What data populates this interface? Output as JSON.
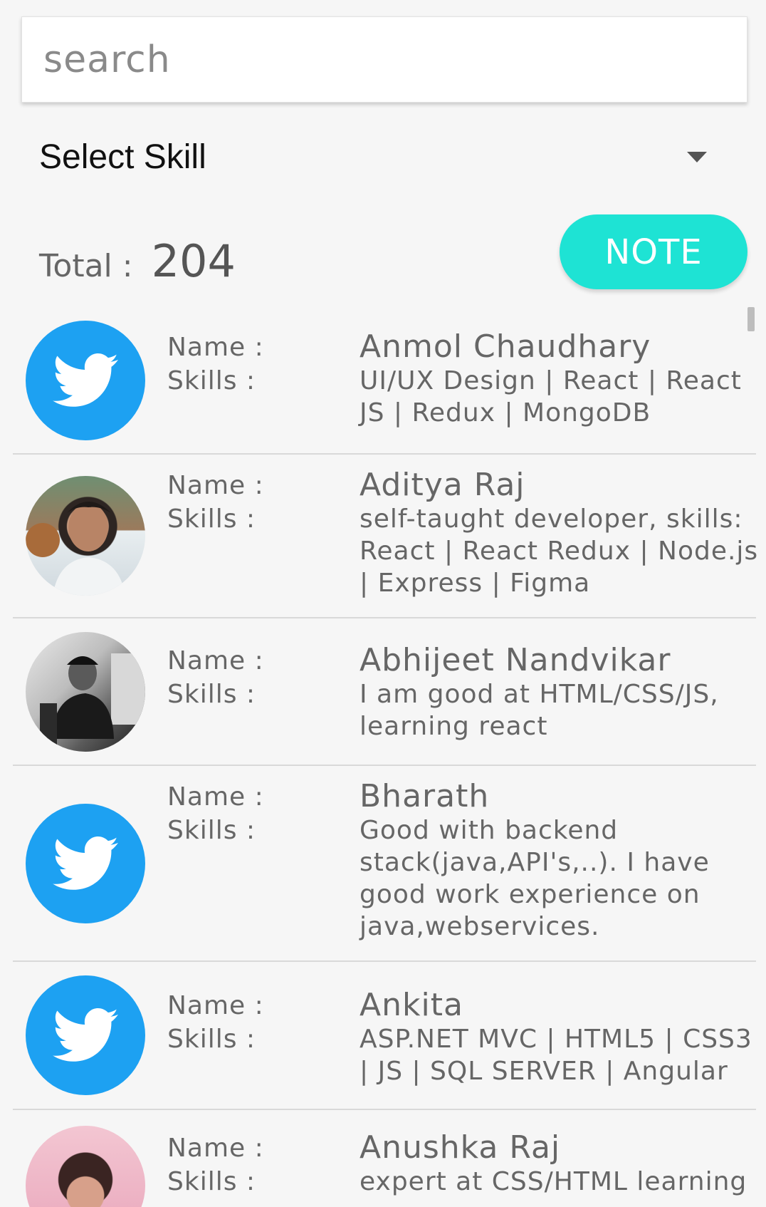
{
  "search": {
    "placeholder": "search"
  },
  "skill_select": {
    "selected": "Select Skill"
  },
  "total": {
    "label": "Total :",
    "count": "204"
  },
  "note_button": {
    "label": "NOTE"
  },
  "field_labels": {
    "name": "Name :",
    "skills": "Skills :"
  },
  "colors": {
    "accent": "#1ee3d4",
    "twitter_blue": "#1da1f2",
    "text_gray": "#666666"
  },
  "users": [
    {
      "name": "Anmol Chaudhary",
      "skills": "UI/UX Design | React | React JS | Redux | MongoDB",
      "avatar": "twitter-icon"
    },
    {
      "name": "Aditya Raj",
      "skills": "self-taught developer, skills: React | React Redux | Node.js | Express | Figma",
      "avatar": "profile-photo"
    },
    {
      "name": "Abhijeet Nandvikar",
      "skills": "I am good at HTML/CSS/JS, learning react",
      "avatar": "profile-photo"
    },
    {
      "name": "Bharath",
      "skills": "Good with backend stack(java,API's,..). I have good work experience on java,webservices.",
      "avatar": "twitter-icon"
    },
    {
      "name": "Ankita",
      "skills": "ASP.NET MVC | HTML5 | CSS3 | JS | SQL SERVER | Angular",
      "avatar": "twitter-icon"
    },
    {
      "name": "Anushka Raj",
      "skills": "expert at CSS/HTML learning",
      "avatar": "profile-photo"
    }
  ]
}
